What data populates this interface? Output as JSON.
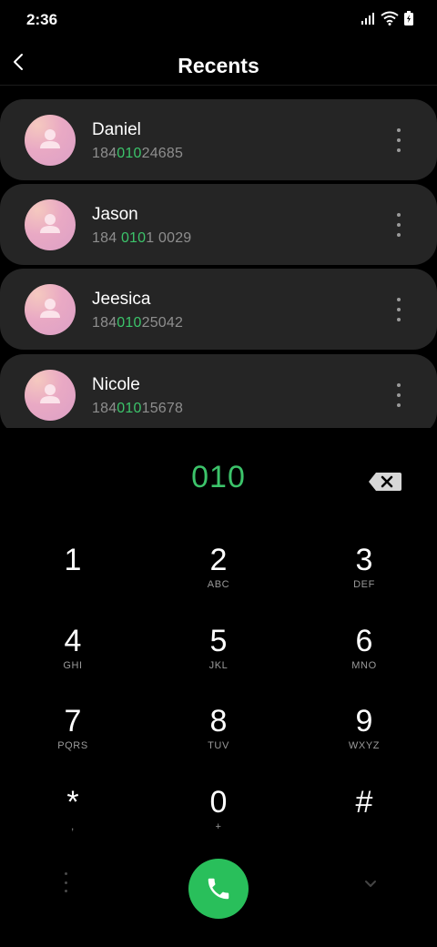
{
  "status_bar": {
    "time": "2:36"
  },
  "header": {
    "title": "Recents"
  },
  "contacts": [
    {
      "name": "Daniel",
      "number_pre": "184",
      "number_match": "010",
      "number_post": "24685"
    },
    {
      "name": "Jason",
      "number_pre": "184 ",
      "number_match": "010",
      "number_post": "1 0029"
    },
    {
      "name": "Jeesica",
      "number_pre": "184",
      "number_match": "010",
      "number_post": "25042"
    },
    {
      "name": "Nicole",
      "number_pre": "184",
      "number_match": "010",
      "number_post": "15678"
    }
  ],
  "dialer": {
    "entered": "010"
  },
  "keypad": [
    {
      "digit": "1",
      "letters": ""
    },
    {
      "digit": "2",
      "letters": "ABC"
    },
    {
      "digit": "3",
      "letters": "DEF"
    },
    {
      "digit": "4",
      "letters": "GHI"
    },
    {
      "digit": "5",
      "letters": "JKL"
    },
    {
      "digit": "6",
      "letters": "MNO"
    },
    {
      "digit": "7",
      "letters": "PQRS"
    },
    {
      "digit": "8",
      "letters": "TUV"
    },
    {
      "digit": "9",
      "letters": "WXYZ"
    },
    {
      "digit": "*",
      "letters": ","
    },
    {
      "digit": "0",
      "letters": "+"
    },
    {
      "digit": "#",
      "letters": ""
    }
  ],
  "colors": {
    "accent": "#3cc36a",
    "call_button": "#29bf5b",
    "card": "#252525"
  },
  "icons": [
    "back-arrow-icon",
    "more-vert-icon",
    "backspace-icon",
    "phone-icon",
    "chevron-down-icon",
    "signal-icon",
    "wifi-icon",
    "battery-icon"
  ]
}
